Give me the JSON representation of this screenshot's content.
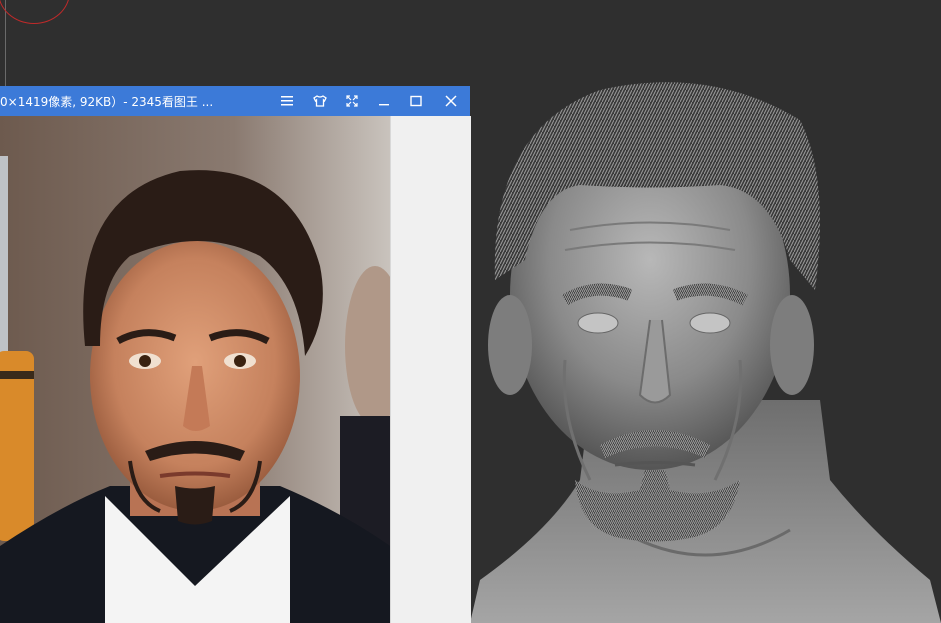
{
  "viewer": {
    "title": "0×1419像素, 92KB）- 2345看图王 ...",
    "buttons": {
      "menu": "menu-icon",
      "skin": "shirt-icon",
      "fullscreen": "expand-icon",
      "minimize": "minimize-icon",
      "maximize": "maximize-icon",
      "close": "close-icon"
    }
  },
  "colors": {
    "canvas": "#2f2f2f",
    "titlebar": "#3c7ad8",
    "brush_ring": "#c02a2a",
    "sculpt_clay": "#8e8e8e"
  }
}
